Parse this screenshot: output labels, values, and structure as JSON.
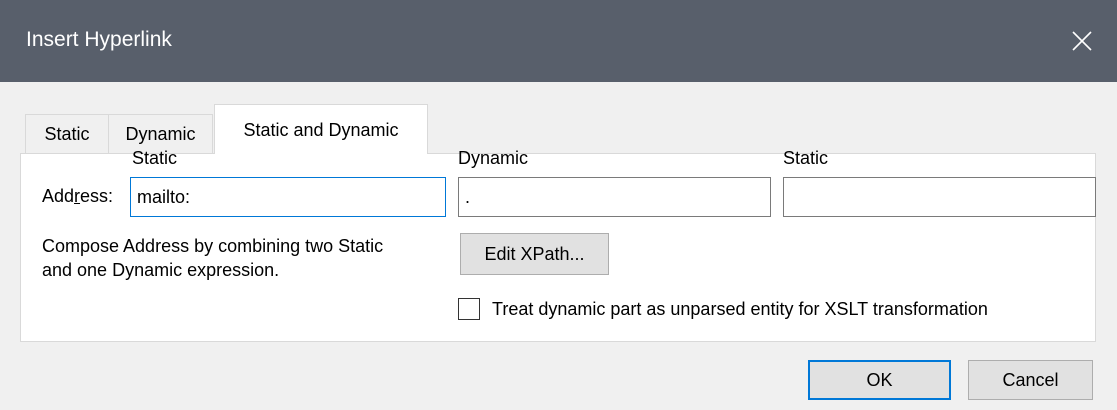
{
  "window": {
    "title": "Insert Hyperlink"
  },
  "tabs": [
    {
      "label": "Static"
    },
    {
      "label": "Dynamic"
    },
    {
      "label": "Static and Dynamic",
      "active": true
    }
  ],
  "address": {
    "label_prefix": "Add",
    "label_mnemonic": "r",
    "label_suffix": "ess:",
    "static1": {
      "header": "Static",
      "value": "mailto:"
    },
    "dynamic": {
      "header": "Dynamic",
      "value": "."
    },
    "static2": {
      "header": "Static",
      "value": ""
    }
  },
  "description": {
    "line1": "Compose Address by combining two Static",
    "line2": "and one Dynamic expression."
  },
  "edit_xpath_button": "Edit XPath...",
  "unparsed_checkbox": {
    "label": "Treat dynamic part as unparsed entity for XSLT transformation",
    "checked": false
  },
  "footer": {
    "ok_label": "OK",
    "cancel_label": "Cancel"
  },
  "icons": {
    "close": "close-icon",
    "checkbox": "checkbox-icon"
  },
  "colors": {
    "titlebar": "#585f6b",
    "focus_accent": "#0078d7",
    "dialog_bg": "#f0f0f0"
  }
}
